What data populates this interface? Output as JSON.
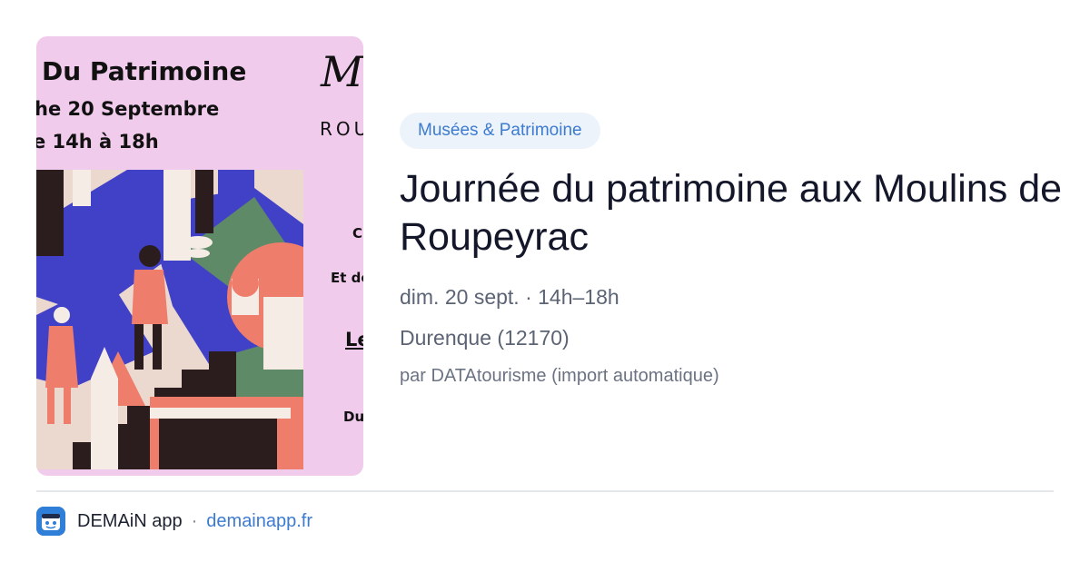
{
  "poster": {
    "line1": "Du Patrimoine",
    "line2": "he 20 Septembre",
    "line3": "e 14h à 18h",
    "script_fragment": "M",
    "word_fragment": "ROU",
    "frag_c": "C",
    "frag_etd": "Et de",
    "frag_le": "Le",
    "frag_du": "Du"
  },
  "event": {
    "category": "Musées & Patrimoine",
    "title": "Journée du patrimoine aux Moulins de Roupeyrac",
    "datetime": "dim. 20 sept. · 14h–18h",
    "location": "Durenque (12170)",
    "source": "par DATAtourisme (import automatique)"
  },
  "footer": {
    "icon": "demain-app-icon",
    "app_name": "DEMAiN app",
    "separator": "·",
    "domain": "demainapp.fr"
  },
  "colors": {
    "accent": "#3c7bd0",
    "category_bg": "#edf3fb",
    "poster_bg": "#f1cbec"
  }
}
